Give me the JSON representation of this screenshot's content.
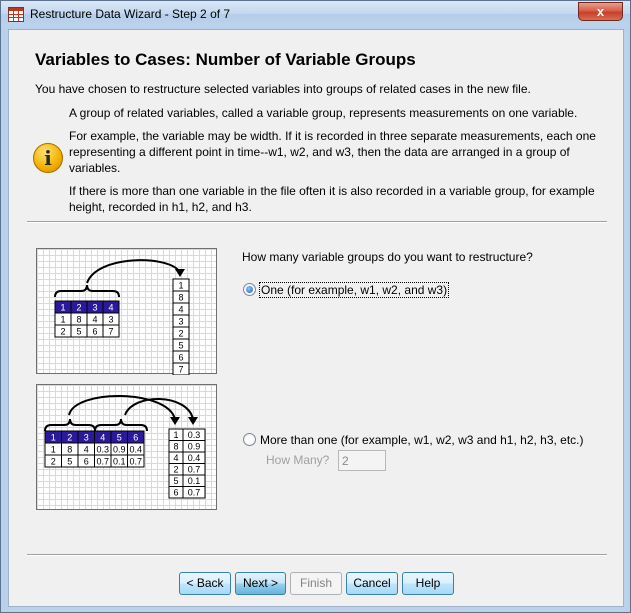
{
  "window": {
    "title": "Restructure Data Wizard - Step 2 of 7",
    "close_glyph": "x",
    "app_icon": "table-grid-icon"
  },
  "header": {
    "title": "Variables to Cases: Number of Variable Groups",
    "intro": "You have chosen to restructure selected variables into groups of related cases in the new file."
  },
  "info": {
    "icon": "info-icon",
    "glyph": "i",
    "para1": "A group of related variables, called a variable group, represents measurements on one variable.",
    "para2": "For example, the variable may be width.  If it is recorded in three separate measurements, each one representing a different point in time--w1, w2, and w3, then the data are arranged in a group of variables.",
    "para3": "If there is more than one variable in the file often it is also recorded in a variable group, for example height, recorded in h1, h2, and h3."
  },
  "diagram_one": {
    "header": [
      "1",
      "2",
      "3",
      "4"
    ],
    "rows": [
      [
        "1",
        "8",
        "4",
        "3"
      ],
      [
        "2",
        "5",
        "6",
        "7"
      ]
    ],
    "column": [
      "1",
      "8",
      "4",
      "3",
      "2",
      "5",
      "6",
      "7"
    ]
  },
  "diagram_more": {
    "header": [
      "1",
      "2",
      "3",
      "4",
      "5",
      "6"
    ],
    "rows": [
      [
        "1",
        "8",
        "4",
        "0.3",
        "0.9",
        "0.4"
      ],
      [
        "2",
        "5",
        "6",
        "0.7",
        "0.1",
        "0.7"
      ]
    ],
    "col_a": [
      "1",
      "8",
      "4",
      "2",
      "5",
      "6"
    ],
    "col_b": [
      "0.3",
      "0.9",
      "0.4",
      "0.7",
      "0.1",
      "0.7"
    ]
  },
  "question": "How many variable groups do you want to restructure?",
  "options": {
    "one": {
      "label": "One (for example, w1, w2, and w3)",
      "selected": true
    },
    "more": {
      "label": "More than one (for example, w1, w2, w3 and h1, h2, h3, etc.)",
      "selected": false
    }
  },
  "how_many": {
    "label": "How Many?",
    "value": "2",
    "enabled": false
  },
  "buttons": {
    "back": "< Back",
    "next": "Next >",
    "finish": "Finish",
    "cancel": "Cancel",
    "help": "Help"
  },
  "colors": {
    "header_cell": "#2a1a9b",
    "window_frame": "#b9d1ea",
    "dialog_bg": "#f0f0f0"
  }
}
